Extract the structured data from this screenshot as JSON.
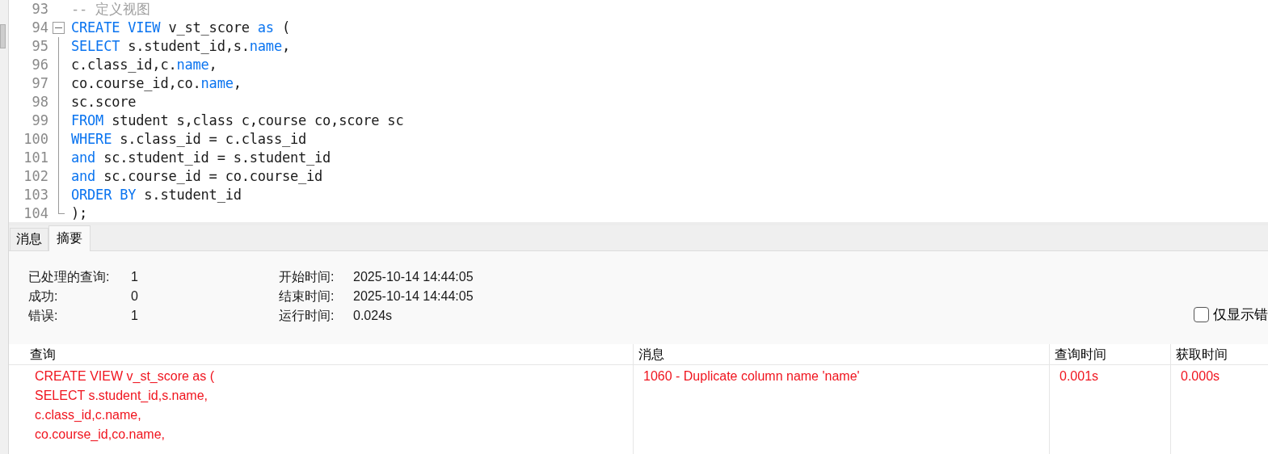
{
  "editor": {
    "lines": [
      {
        "number": "93",
        "kind": "comment",
        "tokens": [
          {
            "kind": "comment",
            "text": "-- 定义视图"
          }
        ]
      },
      {
        "number": "94",
        "kind": "opener",
        "tokens": [
          {
            "kind": "keyword",
            "text": "CREATE VIEW"
          },
          {
            "kind": "plain",
            "text": " v_st_score "
          },
          {
            "kind": "keyword",
            "text": "as"
          },
          {
            "kind": "plain",
            "text": " ("
          }
        ]
      },
      {
        "number": "95",
        "tokens": [
          {
            "kind": "keyword",
            "text": "SELECT"
          },
          {
            "kind": "plain",
            "text": " s.student_id,s."
          },
          {
            "kind": "keyword",
            "text": "name"
          },
          {
            "kind": "plain",
            "text": ","
          }
        ]
      },
      {
        "number": "96",
        "tokens": [
          {
            "kind": "plain",
            "text": "c.class_id,c."
          },
          {
            "kind": "keyword",
            "text": "name"
          },
          {
            "kind": "plain",
            "text": ","
          }
        ]
      },
      {
        "number": "97",
        "tokens": [
          {
            "kind": "plain",
            "text": "co.course_id,co."
          },
          {
            "kind": "keyword",
            "text": "name"
          },
          {
            "kind": "plain",
            "text": ","
          }
        ]
      },
      {
        "number": "98",
        "tokens": [
          {
            "kind": "plain",
            "text": "sc.score"
          }
        ]
      },
      {
        "number": "99",
        "tokens": [
          {
            "kind": "keyword",
            "text": "FROM"
          },
          {
            "kind": "plain",
            "text": " student s,class c,course co,score sc"
          }
        ]
      },
      {
        "number": "100",
        "tokens": [
          {
            "kind": "keyword",
            "text": "WHERE"
          },
          {
            "kind": "plain",
            "text": " s.class_id = c.class_id"
          }
        ]
      },
      {
        "number": "101",
        "tokens": [
          {
            "kind": "keyword",
            "text": "and"
          },
          {
            "kind": "plain",
            "text": " sc.student_id = s.student_id"
          }
        ]
      },
      {
        "number": "102",
        "tokens": [
          {
            "kind": "keyword",
            "text": "and"
          },
          {
            "kind": "plain",
            "text": " sc.course_id = co.course_id"
          }
        ]
      },
      {
        "number": "103",
        "tokens": [
          {
            "kind": "keyword",
            "text": "ORDER BY"
          },
          {
            "kind": "plain",
            "text": " s.student_id"
          }
        ]
      },
      {
        "number": "104",
        "kind": "closer",
        "tokens": [
          {
            "kind": "plain",
            "text": ");"
          }
        ]
      }
    ]
  },
  "tabs": [
    {
      "label": "消息",
      "selected": false
    },
    {
      "label": "摘要",
      "selected": true
    }
  ],
  "summary": {
    "left": [
      {
        "label": "已处理的查询:",
        "value": "1"
      },
      {
        "label": "成功:",
        "value": "0"
      },
      {
        "label": "错误:",
        "value": "1"
      }
    ],
    "right": [
      {
        "label": "开始时间:",
        "value": "2025-10-14 14:44:05"
      },
      {
        "label": "结束时间:",
        "value": "2025-10-14 14:44:05"
      },
      {
        "label": "运行时间:",
        "value": "0.024s"
      }
    ],
    "errors_only": {
      "label": "仅显示错",
      "checked": false
    }
  },
  "table": {
    "columns": [
      "查询",
      "消息",
      "查询时间",
      "获取时间"
    ],
    "rows": [
      {
        "cells": [
          "CREATE VIEW v_st_score as (\nSELECT s.student_id,s.name,\nc.class_id,c.name,\nco.course_id,co.name,",
          "1060 - Duplicate column name 'name'",
          "0.001s",
          "0.000s"
        ]
      }
    ]
  }
}
